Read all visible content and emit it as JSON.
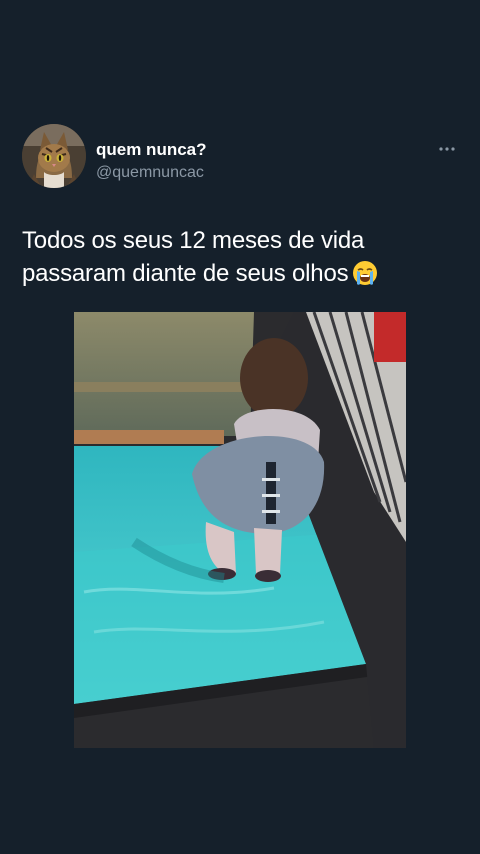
{
  "tweet": {
    "display_name": "quem nunca?",
    "handle": "@quemnuncac",
    "text_lines": [
      "Todos os seus 12 meses de vida",
      "passaram diante de seus olhos"
    ],
    "emoji": "loudly-crying-face"
  },
  "icons": {
    "more": "more-horizontal-icon",
    "avatar": "cat-avatar"
  },
  "colors": {
    "background": "#15202b",
    "primary_text": "#ffffff",
    "secondary_text": "#8b98a5",
    "pool_water": "#3fc3c7"
  }
}
